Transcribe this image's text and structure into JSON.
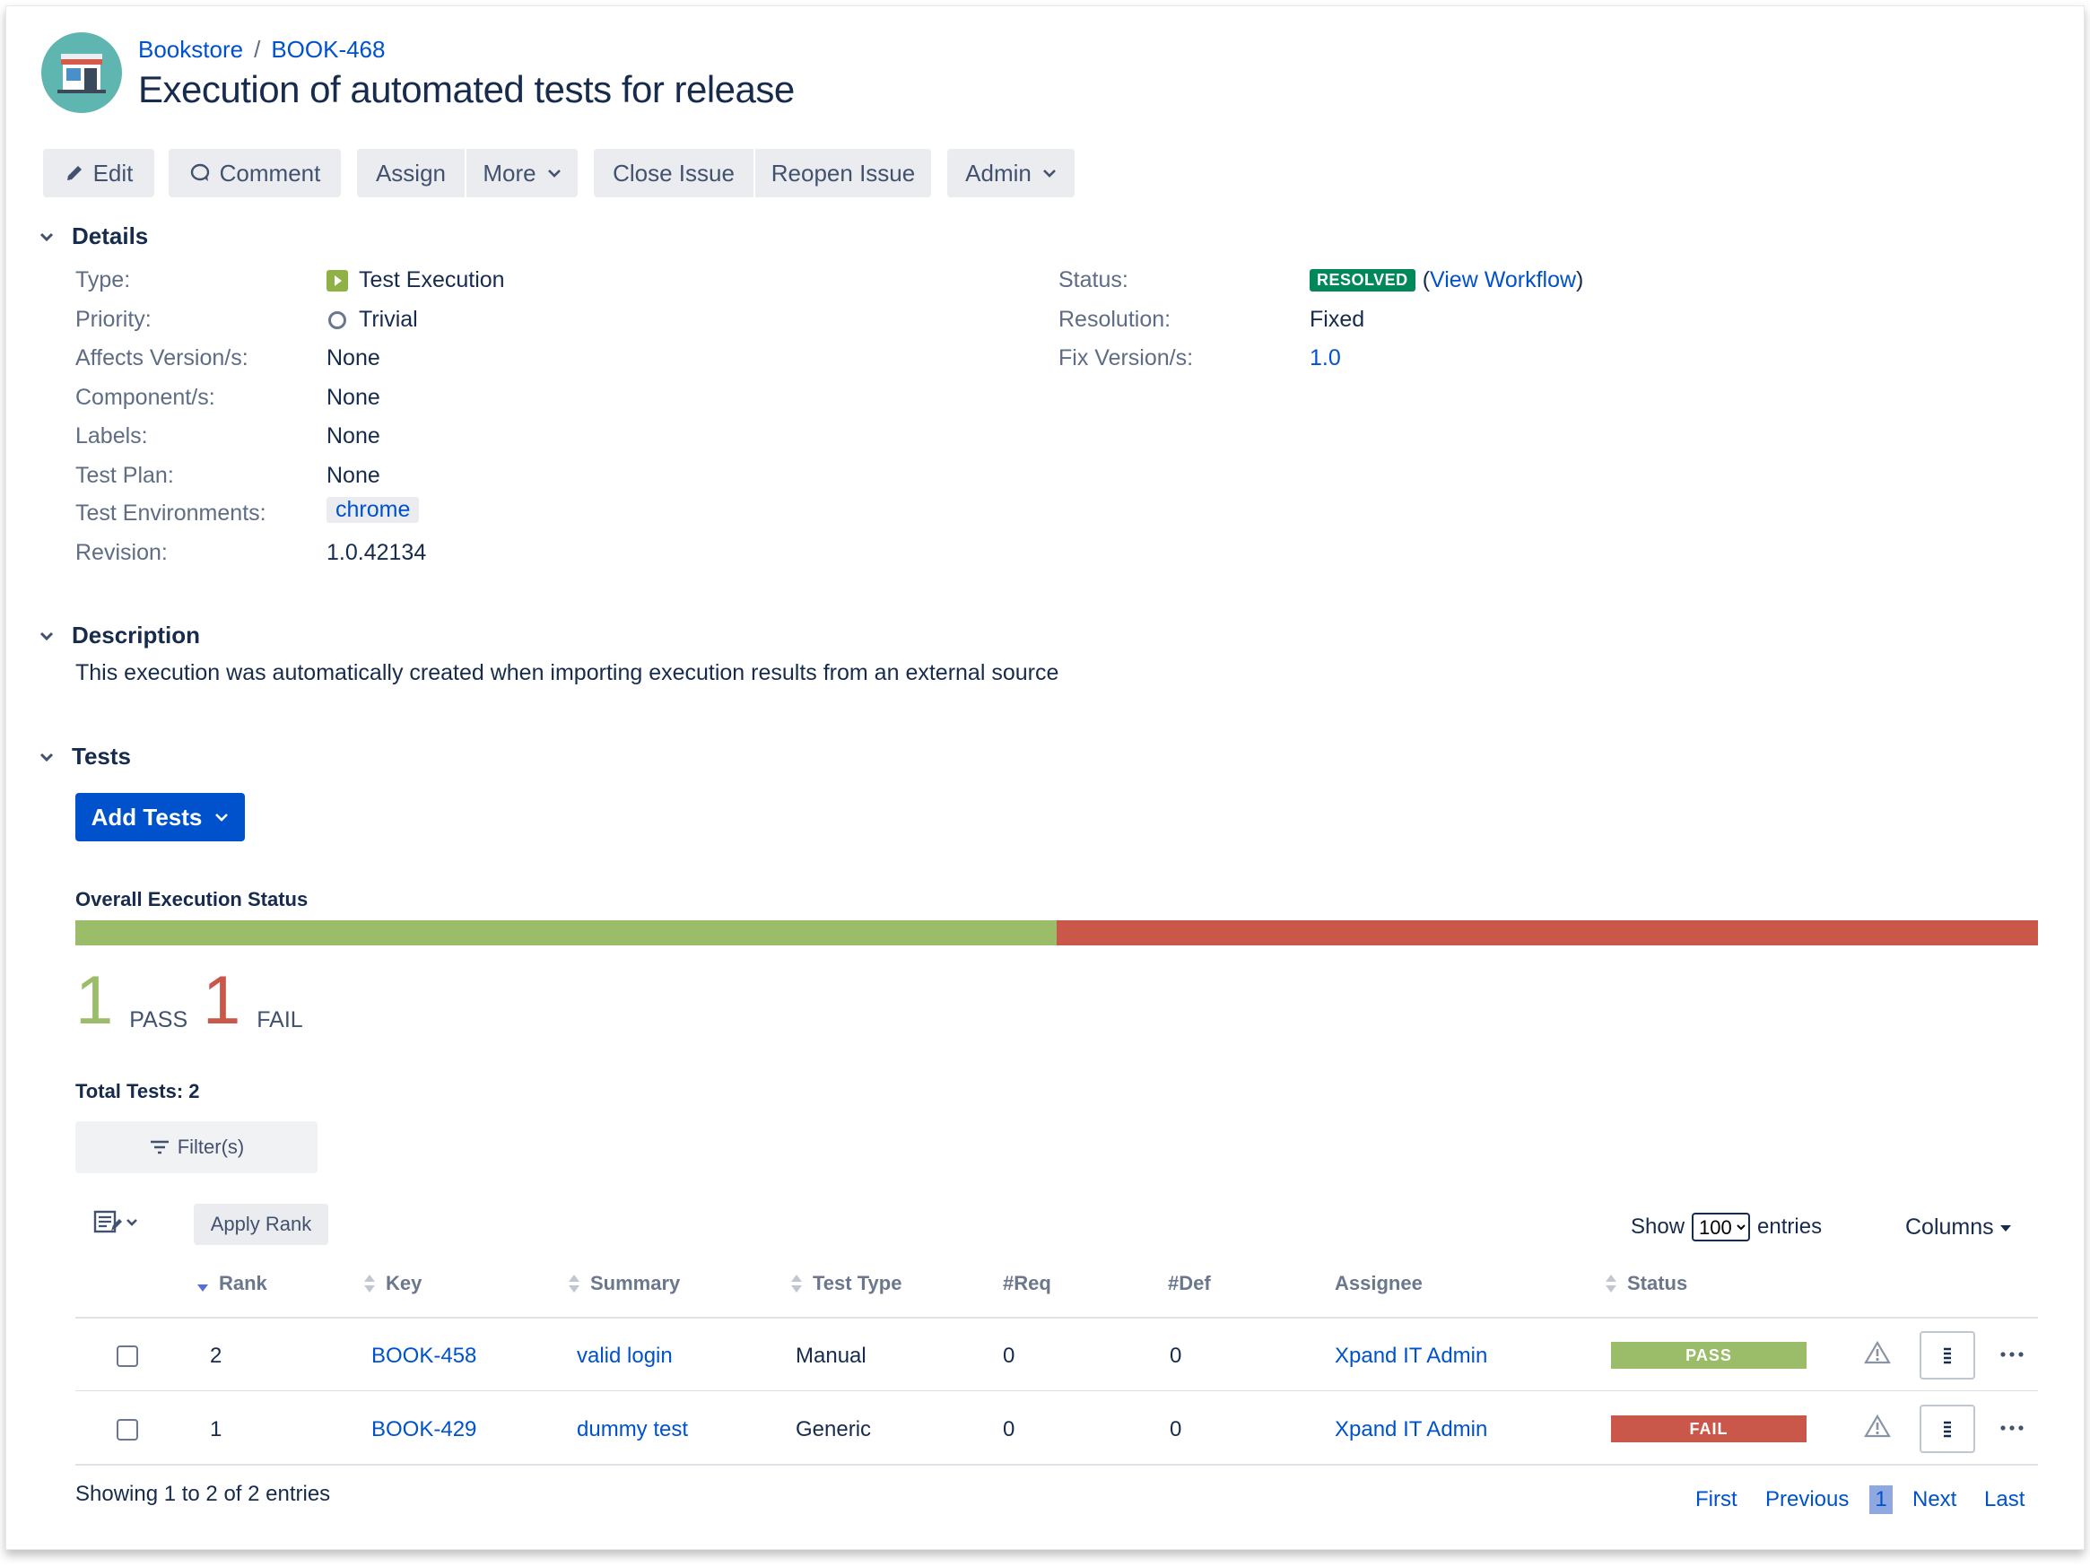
{
  "breadcrumb": {
    "project": "Bookstore",
    "separator": "/",
    "issue_key": "BOOK-468"
  },
  "page_title": "Execution of automated tests for release",
  "toolbar": {
    "edit": "Edit",
    "comment": "Comment",
    "assign": "Assign",
    "more": "More",
    "close_issue": "Close Issue",
    "reopen_issue": "Reopen Issue",
    "admin": "Admin"
  },
  "details": {
    "heading": "Details",
    "left": [
      {
        "label": "Type:",
        "value": "Test Execution"
      },
      {
        "label": "Priority:",
        "value": "Trivial"
      },
      {
        "label": "Affects Version/s:",
        "value": "None"
      },
      {
        "label": "Component/s:",
        "value": "None"
      },
      {
        "label": "Labels:",
        "value": "None"
      },
      {
        "label": "Test Plan:",
        "value": "None"
      },
      {
        "label": "Test Environments:",
        "value": "chrome"
      },
      {
        "label": "Revision:",
        "value": "1.0.42134"
      }
    ],
    "right": [
      {
        "label": "Status:",
        "value": "RESOLVED",
        "extra_open": "(",
        "extra_link": "View Workflow",
        "extra_close": ")"
      },
      {
        "label": "Resolution:",
        "value": "Fixed"
      },
      {
        "label": "Fix Version/s:",
        "value": "1.0"
      }
    ]
  },
  "description": {
    "heading": "Description",
    "text": "This execution was automatically created when importing execution results from an external source"
  },
  "tests": {
    "heading": "Tests",
    "add_button": "Add Tests",
    "overall_label": "Overall Execution Status",
    "pass_fraction": 0.5,
    "fail_fraction": 0.5,
    "pass_count": "1",
    "pass_label": "PASS",
    "fail_count": "1",
    "fail_label": "FAIL",
    "total_label": "Total Tests: 2",
    "filter_label": "Filter(s)",
    "apply_rank": "Apply Rank",
    "show_label": "Show",
    "show_value": "100",
    "entries_label": "entries",
    "columns_label": "Columns",
    "columns": [
      "Rank",
      "Key",
      "Summary",
      "Test Type",
      "#Req",
      "#Def",
      "Assignee",
      "Status"
    ],
    "rows": [
      {
        "rank": "2",
        "key": "BOOK-458",
        "summary": "valid login",
        "test_type": "Manual",
        "req": "0",
        "def": "0",
        "assignee": "Xpand IT Admin",
        "status": "PASS"
      },
      {
        "rank": "1",
        "key": "BOOK-429",
        "summary": "dummy test",
        "test_type": "Generic",
        "req": "0",
        "def": "0",
        "assignee": "Xpand IT Admin",
        "status": "FAIL"
      }
    ],
    "showing": "Showing 1 to 2 of 2 entries",
    "pager": {
      "first": "First",
      "previous": "Previous",
      "current": "1",
      "next": "Next",
      "last": "Last"
    }
  },
  "colors": {
    "pass": "#9bbd69",
    "fail": "#c9584a",
    "link": "#0052cc",
    "primary": "#0052cc",
    "resolved": "#00875a"
  }
}
